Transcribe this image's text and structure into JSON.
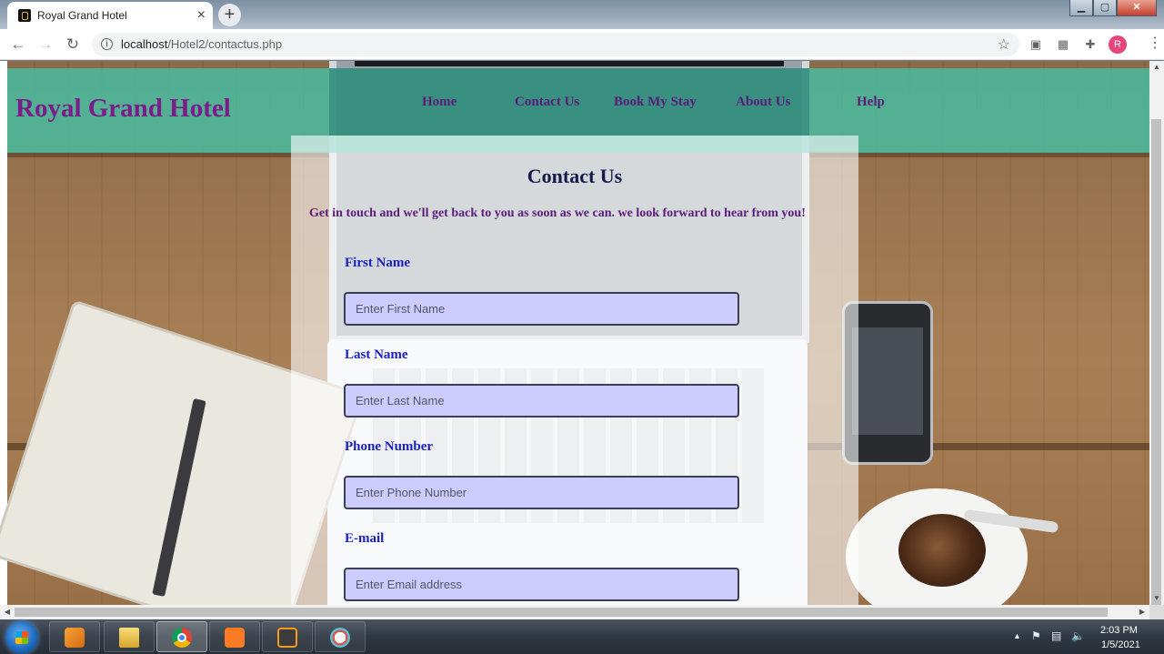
{
  "browser": {
    "tab_title": "Royal Grand Hotel",
    "tab_close": "×",
    "new_tab": "+",
    "url_host": "localhost",
    "url_path": "/Hotel2/contactus.php",
    "profile_initial": "R"
  },
  "site": {
    "brand": "Royal Grand Hotel",
    "nav": [
      "Home",
      "Contact Us",
      "Book My Stay",
      "About Us",
      "Help"
    ]
  },
  "contact": {
    "title": "Contact Us",
    "subtitle": "Get in touch and we'll get back to you as soon as we can. we look forward to hear from you!",
    "fields": [
      {
        "label": "First Name",
        "placeholder": "Enter First Name",
        "value": ""
      },
      {
        "label": "Last Name",
        "placeholder": "Enter Last Name",
        "value": ""
      },
      {
        "label": "Phone Number",
        "placeholder": "Enter Phone Number",
        "value": ""
      },
      {
        "label": "E-mail",
        "placeholder": "Enter Email address",
        "value": ""
      }
    ]
  },
  "taskbar": {
    "items": [
      "media-player",
      "file-explorer",
      "chrome",
      "xampp",
      "sublime-text",
      "paint"
    ],
    "active": "chrome",
    "time": "2:03 PM",
    "date": "1/5/2021"
  },
  "colors": {
    "header_teal": "#46bea4",
    "brand_purple": "#7b1c8a",
    "nav_purple": "#5a1c7a",
    "label_blue": "#1a20c8",
    "input_bg": "#ccccff"
  }
}
